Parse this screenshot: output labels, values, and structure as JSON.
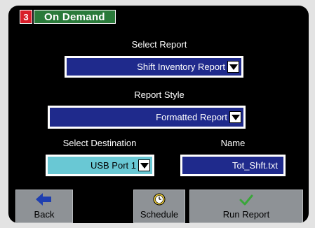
{
  "title": {
    "number": "3",
    "text": "On Demand"
  },
  "select_report": {
    "label": "Select Report",
    "value": "Shift Inventory Report"
  },
  "report_style": {
    "label": "Report Style",
    "value": "Formatted Report"
  },
  "destination": {
    "label": "Select Destination",
    "value": "USB Port 1"
  },
  "name": {
    "label": "Name",
    "value": "Tot_Shft.txt"
  },
  "buttons": {
    "back": "Back",
    "schedule": "Schedule",
    "run": "Run Report"
  },
  "colors": {
    "accent_blue": "#1f2a8c",
    "title_green": "#2a7a3a",
    "title_red": "#d81e2a",
    "light_field": "#69c8d4"
  }
}
